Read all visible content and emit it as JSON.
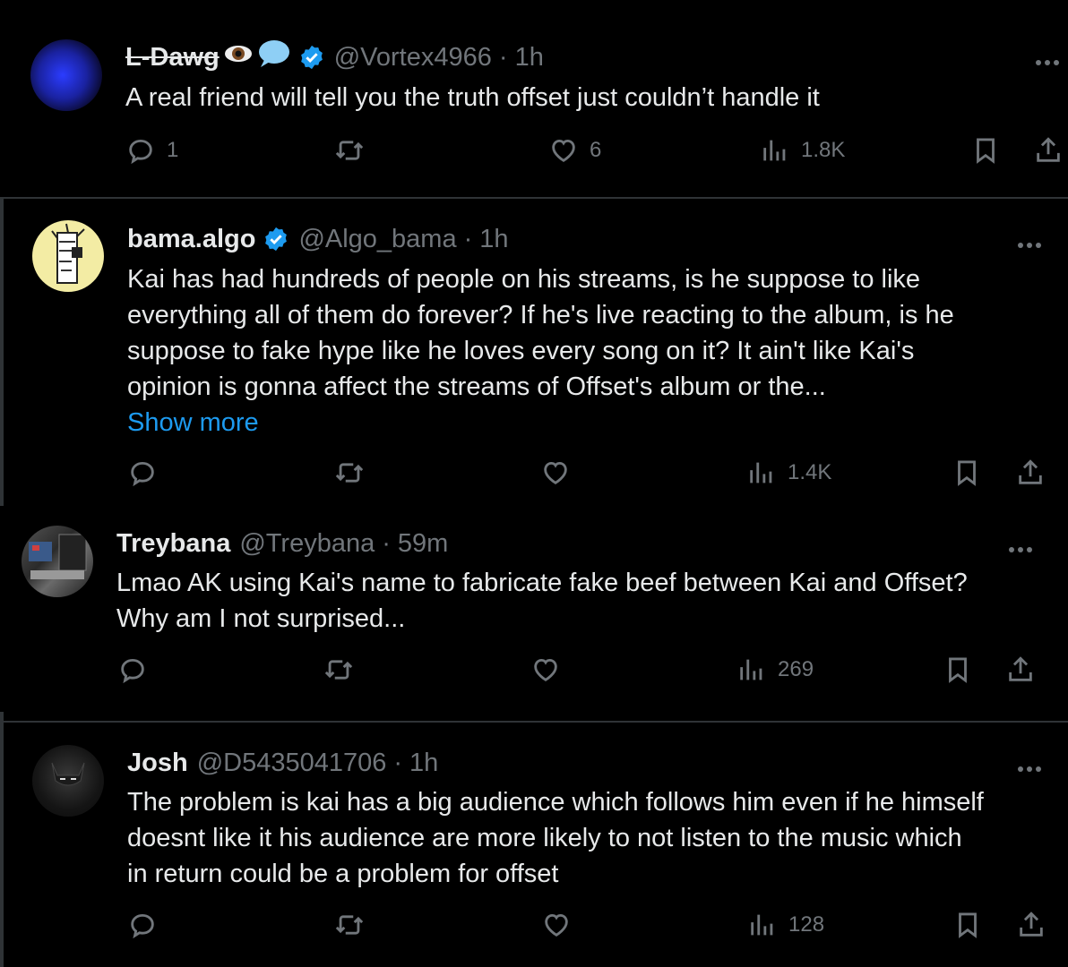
{
  "tweets": [
    {
      "name": "L-Dawg",
      "handle": "@Vortex4966",
      "time": "1h",
      "text": [
        "A real friend will tell you the truth offset just couldn’t handle it"
      ],
      "replies": "1",
      "likes": "6",
      "views": "1.8K",
      "verified": true
    },
    {
      "name": "bama.algo",
      "handle": "@Algo_bama",
      "time": "1h",
      "text": [
        "Kai has had hundreds of people on his streams, is he suppose to like",
        "everything all of them do forever? If he's live reacting to the album, is he",
        "suppose to fake hype like he loves every song on it? It ain't like Kai's",
        "opinion is gonna affect the streams of Offset's album or the..."
      ],
      "show_more": "Show more",
      "views": "1.4K",
      "verified": true
    },
    {
      "name": "Treybana",
      "handle": "@Treybana",
      "time": "59m",
      "text": [
        "Lmao AK using Kai's name to fabricate fake beef between Kai and Offset?",
        "Why am I not surprised..."
      ],
      "views": "269"
    },
    {
      "name": "Josh",
      "handle": "@D5435041706",
      "time": "1h",
      "text": [
        "The problem is kai has a big audience which follows him even if he himself",
        "doesnt like it his audience are more likely to not listen to the music which",
        "in return could be a problem for offset"
      ],
      "views": "128"
    }
  ],
  "separator": "·",
  "colors": {
    "background": "#000000",
    "text": "#e7e9ea",
    "muted": "#71767b",
    "link": "#1d9bf0",
    "verified": "#1d9bf0"
  }
}
